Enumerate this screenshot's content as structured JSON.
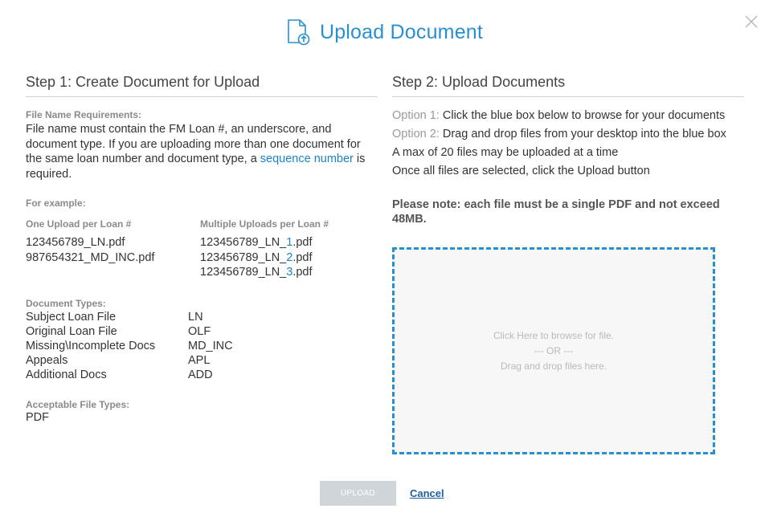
{
  "dialog": {
    "title": "Upload Document",
    "colors": {
      "accent": "#2a8fd1",
      "disabled_button": "#cfd5d9",
      "link": "#1a83c9"
    }
  },
  "step1": {
    "title": "Step 1: Create Document for Upload",
    "requirements_label": "File Name Requirements:",
    "requirements_text_before": "File name must contain the FM Loan #, an underscore, and document type. If you are uploading more than one document for the same loan number and document type, a ",
    "requirements_link": "sequence number",
    "requirements_text_after": " is required.",
    "example_label": "For example:",
    "single_upload": {
      "heading": "One Upload per Loan #",
      "files": [
        "123456789_LN.pdf",
        "987654321_MD_INC.pdf"
      ]
    },
    "multiple_upload": {
      "heading": "Multiple Uploads per Loan #",
      "files": [
        {
          "prefix": "123456789_LN_",
          "seq": "1",
          "suffix": ".pdf"
        },
        {
          "prefix": "123456789_LN_",
          "seq": "2",
          "suffix": ".pdf"
        },
        {
          "prefix": "123456789_LN_",
          "seq": "3",
          "suffix": ".pdf"
        }
      ]
    },
    "doc_types_label": "Document Types:",
    "doc_types": [
      {
        "name": "Subject Loan File",
        "code": "LN"
      },
      {
        "name": "Original Loan File",
        "code": "OLF"
      },
      {
        "name": "Missing\\Incomplete Docs",
        "code": "MD_INC"
      },
      {
        "name": "Appeals",
        "code": "APL"
      },
      {
        "name": "Additional Docs",
        "code": "ADD"
      }
    ],
    "file_types_label": "Acceptable File Types:",
    "file_types": "PDF"
  },
  "step2": {
    "title": "Step 2: Upload Documents",
    "option1_label": "Option 1:",
    "option1_text": " Click the blue box below to browse for your documents",
    "option2_label": "Option 2:",
    "option2_text": " Drag and drop files from your desktop into the blue box",
    "max_files": "A max of 20 files may be uploaded at a time",
    "instruction": "Once all files are selected, click the Upload button",
    "note": "Please note: each file must be a single PDF and not exceed 48MB."
  },
  "dropzone": {
    "line1": "Click Here to browse for file.",
    "line2": "--- OR ---",
    "line3": "Drag and drop files here."
  },
  "footer": {
    "upload_label": "UPLOAD",
    "cancel_label": "Cancel"
  }
}
